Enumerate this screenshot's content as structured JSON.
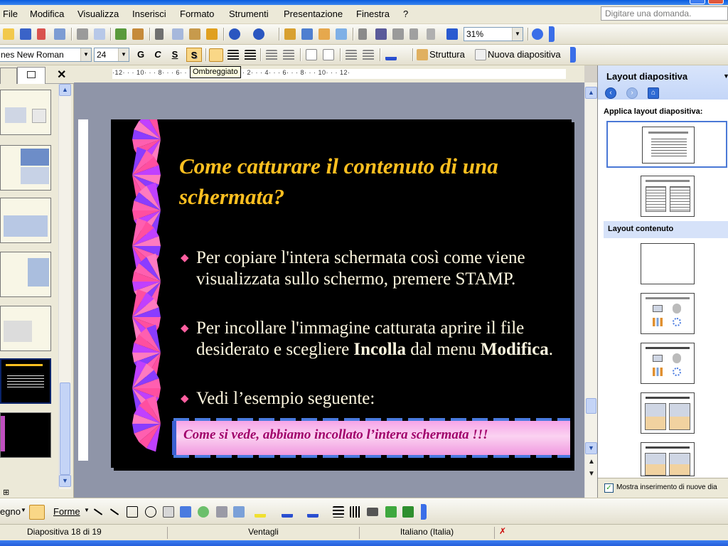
{
  "menu": [
    "File",
    "Modifica",
    "Visualizza",
    "Inserisci",
    "Formato",
    "Strumenti",
    "Presentazione",
    "Finestra",
    "?"
  ],
  "help_placeholder": "Digitare una domanda.",
  "toolbar": {
    "zoom": "31%",
    "font": "Times New Roman",
    "font_display": "nes New Roman",
    "size": "24",
    "bold": "G",
    "italic": "C",
    "underline": "S",
    "shadow": "S",
    "structure": "Struttura",
    "new_slide": "Nuova diapositiva",
    "tooltip": "Ombreggiato"
  },
  "ruler_text": "·12· · · 10· · · 8· · · 6· · · 4· · · 2· · · 0· · · 2· · · 4· · · 6· · · 8· · · 10· · · 12·",
  "slide": {
    "title": "Come catturare il contenuto di una schermata?",
    "bullet1": "Per copiare l'intera schermata così come viene visualizzata sullo schermo, premere STAMP.",
    "bullet2_pre": "Per incollare l'immagine catturata aprire il file desiderato e scegliere ",
    "bullet2_bold1": "Incolla",
    "bullet2_mid": " dal menu ",
    "bullet2_bold2": "Modifica",
    "bullet2_end": ".",
    "bullet3": "Vedi l’esempio seguente:",
    "banner": "Come si vede, abbiamo incollato l’intera schermata !!!",
    "bullet_symbol": "◆"
  },
  "taskpane": {
    "title": "Layout diapositiva",
    "apply_label": "Applica layout diapositiva:",
    "section_content": "Layout contenuto",
    "checkbox_label": "Mostra inserimento di nuove dia"
  },
  "drawing": {
    "draw_label": "egno",
    "shapes_label": "Forme"
  },
  "status": {
    "slide": "Diapositiva 18 di 19",
    "design": "Ventagli",
    "language": "Italiano (Italia)"
  },
  "colors": {
    "title": "#ffc020",
    "body": "#fff8e0",
    "bullet": "#ff5fa0",
    "banner_text": "#a0006a"
  }
}
